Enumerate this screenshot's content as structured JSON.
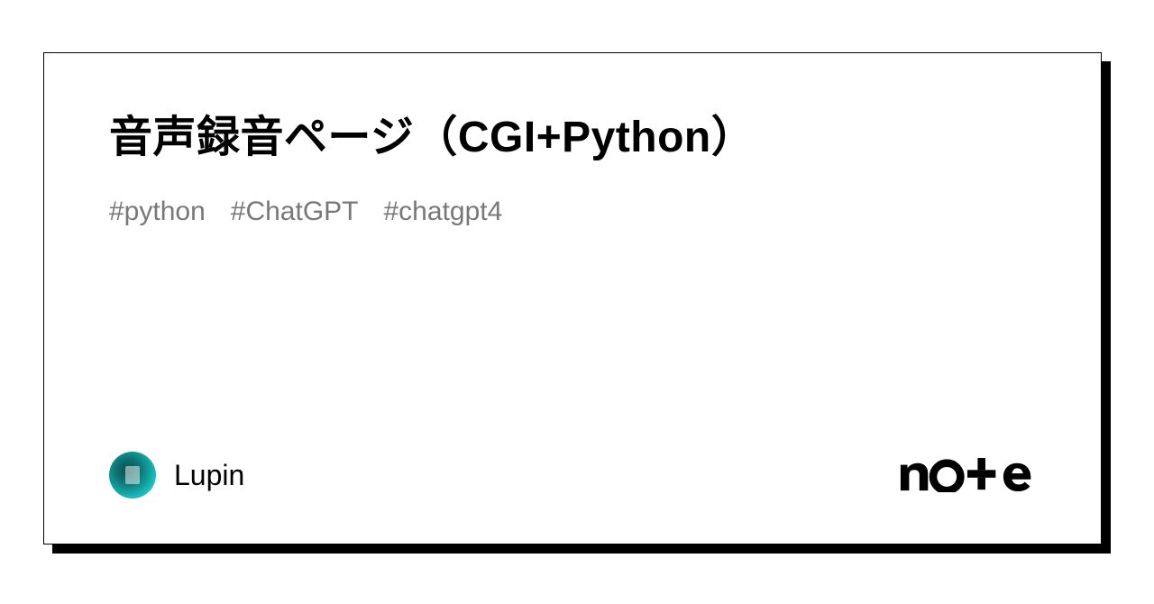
{
  "title": "音声録音ページ（CGI+Python）",
  "tags": [
    "#python",
    "#ChatGPT",
    "#chatgpt4"
  ],
  "author": {
    "name": "Lupin"
  },
  "brand": "note"
}
